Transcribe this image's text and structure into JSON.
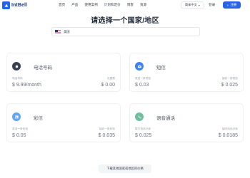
{
  "header": {
    "logo_text": "IntBell",
    "nav": [
      "首页",
      "产品",
      "使用案例",
      "计划和定价",
      "博客",
      "资源"
    ],
    "language": "简体中文",
    "login": "登录",
    "signup": "注册"
  },
  "title": "请选择一个国家/地区",
  "country": {
    "name": "美国",
    "flag_icon": "us-flag-icon"
  },
  "cards": [
    {
      "title": "电话号码",
      "icon": "phone-icon",
      "icon_color": "#374151",
      "left_label": "电话号码",
      "left_value": "$ 9.99/month",
      "right_label": "设置费",
      "right_value": "$ 0.00"
    },
    {
      "title": "短信",
      "icon": "mail-icon",
      "icon_color": "#3b82f6",
      "left_label": "发送一条短信",
      "left_value": "$ 0.03",
      "right_label": "接收一条短信",
      "right_value": "$ 0.025"
    },
    {
      "title": "彩信",
      "icon": "image-icon",
      "icon_color": "#60a5fa",
      "left_label": "发送一条彩信",
      "left_value": "$ 0.05",
      "right_label": "接收一条彩信",
      "right_value": "$ 0.035"
    },
    {
      "title": "语音通话",
      "icon": "call-icon",
      "icon_color": "#6fbf9e",
      "left_label": "拨打电话分钟",
      "left_value": "$ 0.025",
      "right_label": "接听电话分钟",
      "right_value": "$ 0.0185"
    }
  ],
  "footer_button": "下载其他国家或地区的价格"
}
